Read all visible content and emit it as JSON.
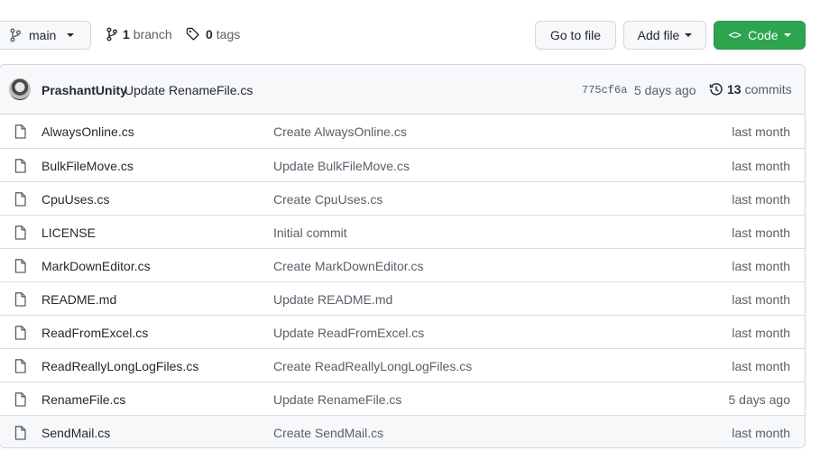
{
  "toolbar": {
    "branch_label": "main",
    "branch_count": "1",
    "branch_word": "branch",
    "tag_count": "0",
    "tag_word": "tags",
    "go_to_file": "Go to file",
    "add_file": "Add file",
    "code": "Code",
    "code_icon_glyph": "<>",
    "code_color": "#2da44e"
  },
  "latest_commit": {
    "author": "PrashantUnity",
    "message": "Update RenameFile.cs",
    "sha": "775cf6a",
    "ago": "5 days ago",
    "commit_count": "13",
    "commit_word": "commits"
  },
  "files": [
    {
      "name": "AlwaysOnline.cs",
      "message": "Create AlwaysOnline.cs",
      "age": "last month"
    },
    {
      "name": "BulkFileMove.cs",
      "message": "Update BulkFileMove.cs",
      "age": "last month"
    },
    {
      "name": "CpuUses.cs",
      "message": "Create CpuUses.cs",
      "age": "last month"
    },
    {
      "name": "LICENSE",
      "message": "Initial commit",
      "age": "last month"
    },
    {
      "name": "MarkDownEditor.cs",
      "message": "Create MarkDownEditor.cs",
      "age": "last month"
    },
    {
      "name": "README.md",
      "message": "Update README.md",
      "age": "last month"
    },
    {
      "name": "ReadFromExcel.cs",
      "message": "Update ReadFromExcel.cs",
      "age": "last month"
    },
    {
      "name": "ReadReallyLongLogFiles.cs",
      "message": "Create ReadReallyLongLogFiles.cs",
      "age": "last month"
    },
    {
      "name": "RenameFile.cs",
      "message": "Update RenameFile.cs",
      "age": "5 days ago"
    },
    {
      "name": "SendMail.cs",
      "message": "Create SendMail.cs",
      "age": "last month"
    }
  ],
  "icons": {
    "branch": "git-branch-icon",
    "tag": "tag-icon",
    "history": "history-icon",
    "file": "file-icon"
  }
}
